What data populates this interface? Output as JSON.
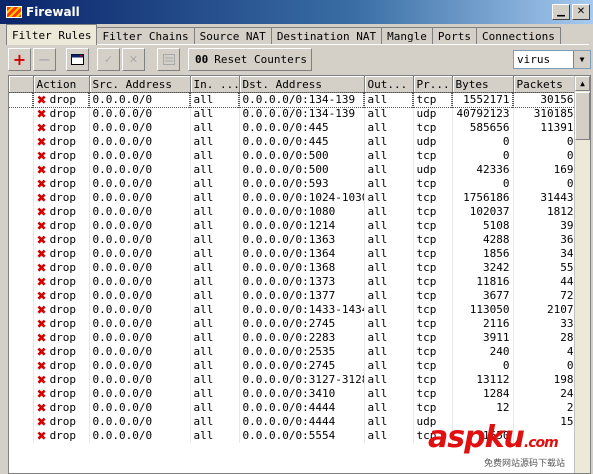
{
  "window": {
    "title": "Firewall"
  },
  "tabs": [
    "Filter Rules",
    "Filter Chains",
    "Source NAT",
    "Destination NAT",
    "Mangle",
    "Ports",
    "Connections"
  ],
  "toolbar": {
    "reset_label": "Reset Counters",
    "reset_prefix": "00",
    "filter_value": "virus"
  },
  "columns": [
    "",
    "Action",
    "Src. Address",
    "In. ...",
    "Dst. Address",
    "Out...",
    "Pr...",
    "Bytes",
    "Packets"
  ],
  "rows": [
    {
      "action": "drop",
      "src": "0.0.0.0/0",
      "in": "all",
      "dst": "0.0.0.0/0:134-139",
      "out": "all",
      "proto": "tcp",
      "bytes": "1552171",
      "packets": "30156"
    },
    {
      "action": "drop",
      "src": "0.0.0.0/0",
      "in": "all",
      "dst": "0.0.0.0/0:134-139",
      "out": "all",
      "proto": "udp",
      "bytes": "40792123",
      "packets": "310185"
    },
    {
      "action": "drop",
      "src": "0.0.0.0/0",
      "in": "all",
      "dst": "0.0.0.0/0:445",
      "out": "all",
      "proto": "tcp",
      "bytes": "585656",
      "packets": "11391"
    },
    {
      "action": "drop",
      "src": "0.0.0.0/0",
      "in": "all",
      "dst": "0.0.0.0/0:445",
      "out": "all",
      "proto": "udp",
      "bytes": "0",
      "packets": "0"
    },
    {
      "action": "drop",
      "src": "0.0.0.0/0",
      "in": "all",
      "dst": "0.0.0.0/0:500",
      "out": "all",
      "proto": "tcp",
      "bytes": "0",
      "packets": "0"
    },
    {
      "action": "drop",
      "src": "0.0.0.0/0",
      "in": "all",
      "dst": "0.0.0.0/0:500",
      "out": "all",
      "proto": "udp",
      "bytes": "42336",
      "packets": "169"
    },
    {
      "action": "drop",
      "src": "0.0.0.0/0",
      "in": "all",
      "dst": "0.0.0.0/0:593",
      "out": "all",
      "proto": "tcp",
      "bytes": "0",
      "packets": "0"
    },
    {
      "action": "drop",
      "src": "0.0.0.0/0",
      "in": "all",
      "dst": "0.0.0.0/0:1024-1030",
      "out": "all",
      "proto": "tcp",
      "bytes": "1756186",
      "packets": "31443"
    },
    {
      "action": "drop",
      "src": "0.0.0.0/0",
      "in": "all",
      "dst": "0.0.0.0/0:1080",
      "out": "all",
      "proto": "tcp",
      "bytes": "102037",
      "packets": "1812"
    },
    {
      "action": "drop",
      "src": "0.0.0.0/0",
      "in": "all",
      "dst": "0.0.0.0/0:1214",
      "out": "all",
      "proto": "tcp",
      "bytes": "5108",
      "packets": "39"
    },
    {
      "action": "drop",
      "src": "0.0.0.0/0",
      "in": "all",
      "dst": "0.0.0.0/0:1363",
      "out": "all",
      "proto": "tcp",
      "bytes": "4288",
      "packets": "36"
    },
    {
      "action": "drop",
      "src": "0.0.0.0/0",
      "in": "all",
      "dst": "0.0.0.0/0:1364",
      "out": "all",
      "proto": "tcp",
      "bytes": "1856",
      "packets": "34"
    },
    {
      "action": "drop",
      "src": "0.0.0.0/0",
      "in": "all",
      "dst": "0.0.0.0/0:1368",
      "out": "all",
      "proto": "tcp",
      "bytes": "3242",
      "packets": "55"
    },
    {
      "action": "drop",
      "src": "0.0.0.0/0",
      "in": "all",
      "dst": "0.0.0.0/0:1373",
      "out": "all",
      "proto": "tcp",
      "bytes": "11816",
      "packets": "44"
    },
    {
      "action": "drop",
      "src": "0.0.0.0/0",
      "in": "all",
      "dst": "0.0.0.0/0:1377",
      "out": "all",
      "proto": "tcp",
      "bytes": "3677",
      "packets": "72"
    },
    {
      "action": "drop",
      "src": "0.0.0.0/0",
      "in": "all",
      "dst": "0.0.0.0/0:1433-1434",
      "out": "all",
      "proto": "tcp",
      "bytes": "113050",
      "packets": "2107"
    },
    {
      "action": "drop",
      "src": "0.0.0.0/0",
      "in": "all",
      "dst": "0.0.0.0/0:2745",
      "out": "all",
      "proto": "tcp",
      "bytes": "2116",
      "packets": "33"
    },
    {
      "action": "drop",
      "src": "0.0.0.0/0",
      "in": "all",
      "dst": "0.0.0.0/0:2283",
      "out": "all",
      "proto": "tcp",
      "bytes": "3911",
      "packets": "28"
    },
    {
      "action": "drop",
      "src": "0.0.0.0/0",
      "in": "all",
      "dst": "0.0.0.0/0:2535",
      "out": "all",
      "proto": "tcp",
      "bytes": "240",
      "packets": "4"
    },
    {
      "action": "drop",
      "src": "0.0.0.0/0",
      "in": "all",
      "dst": "0.0.0.0/0:2745",
      "out": "all",
      "proto": "tcp",
      "bytes": "0",
      "packets": "0"
    },
    {
      "action": "drop",
      "src": "0.0.0.0/0",
      "in": "all",
      "dst": "0.0.0.0/0:3127-3128",
      "out": "all",
      "proto": "tcp",
      "bytes": "13112",
      "packets": "198"
    },
    {
      "action": "drop",
      "src": "0.0.0.0/0",
      "in": "all",
      "dst": "0.0.0.0/0:3410",
      "out": "all",
      "proto": "tcp",
      "bytes": "1284",
      "packets": "24"
    },
    {
      "action": "drop",
      "src": "0.0.0.0/0",
      "in": "all",
      "dst": "0.0.0.0/0:4444",
      "out": "all",
      "proto": "tcp",
      "bytes": "12",
      "packets": "2"
    },
    {
      "action": "drop",
      "src": "0.0.0.0/0",
      "in": "all",
      "dst": "0.0.0.0/0:4444",
      "out": "all",
      "proto": "udp",
      "bytes": "",
      "packets": "15"
    },
    {
      "action": "drop",
      "src": "0.0.0.0/0",
      "in": "all",
      "dst": "0.0.0.0/0:5554",
      "out": "all",
      "proto": "tcp",
      "bytes": "1550",
      "packets": ""
    }
  ],
  "watermark": {
    "text": "aspku",
    "suffix": ".com",
    "sub": "免费网站源码下载站"
  }
}
